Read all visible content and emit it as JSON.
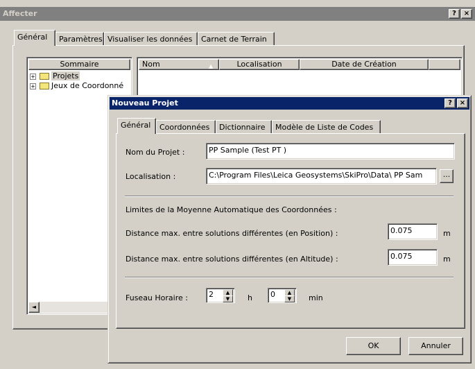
{
  "main_window": {
    "title": "Affecter",
    "help_btn": "?",
    "close_btn": "×",
    "tabs": [
      "Général",
      "Paramètres",
      "Visualiser les données",
      "Carnet de Terrain"
    ],
    "tree_header": "Sommaire",
    "tree_items": [
      {
        "label": "Projets",
        "expander": "+"
      },
      {
        "label": "Jeux de Coordonné",
        "expander": "+"
      }
    ],
    "list_columns": [
      "Nom",
      "Localisation",
      "Date de Création"
    ],
    "sort_icon": "sort-up-icon",
    "scroll_left_icon": "◄"
  },
  "dialog": {
    "title": "Nouveau Projet",
    "help_btn": "?",
    "close_btn": "×",
    "tabs": [
      "Général",
      "Coordonnées",
      "Dictionnaire",
      "Modèle de Liste de Codes"
    ],
    "project_name_label": "Nom du Projet :",
    "project_name_value": "PP Sample (Test PT )",
    "location_label": "Localisation :",
    "location_value": "C:\\Program Files\\Leica Geosystems\\SkiPro\\Data\\ PP Sam",
    "browse_label": "...",
    "limits_heading": "Limites de la Moyenne Automatique des Coordonnées :",
    "dist_position_label": "Distance max. entre solutions différentes (en Position) :",
    "dist_position_value": "0.075",
    "dist_altitude_label": "Distance max. entre solutions différentes (en Altitude) :",
    "dist_altitude_value": "0.075",
    "unit_m": "m",
    "timezone_label": "Fuseau Horaire :",
    "tz_hours_value": "2",
    "tz_hours_unit": "h",
    "tz_minutes_value": "0",
    "tz_minutes_unit": "min",
    "spin_up": "▲",
    "spin_down": "▼",
    "ok_label": "OK",
    "cancel_label": "Annuler"
  }
}
